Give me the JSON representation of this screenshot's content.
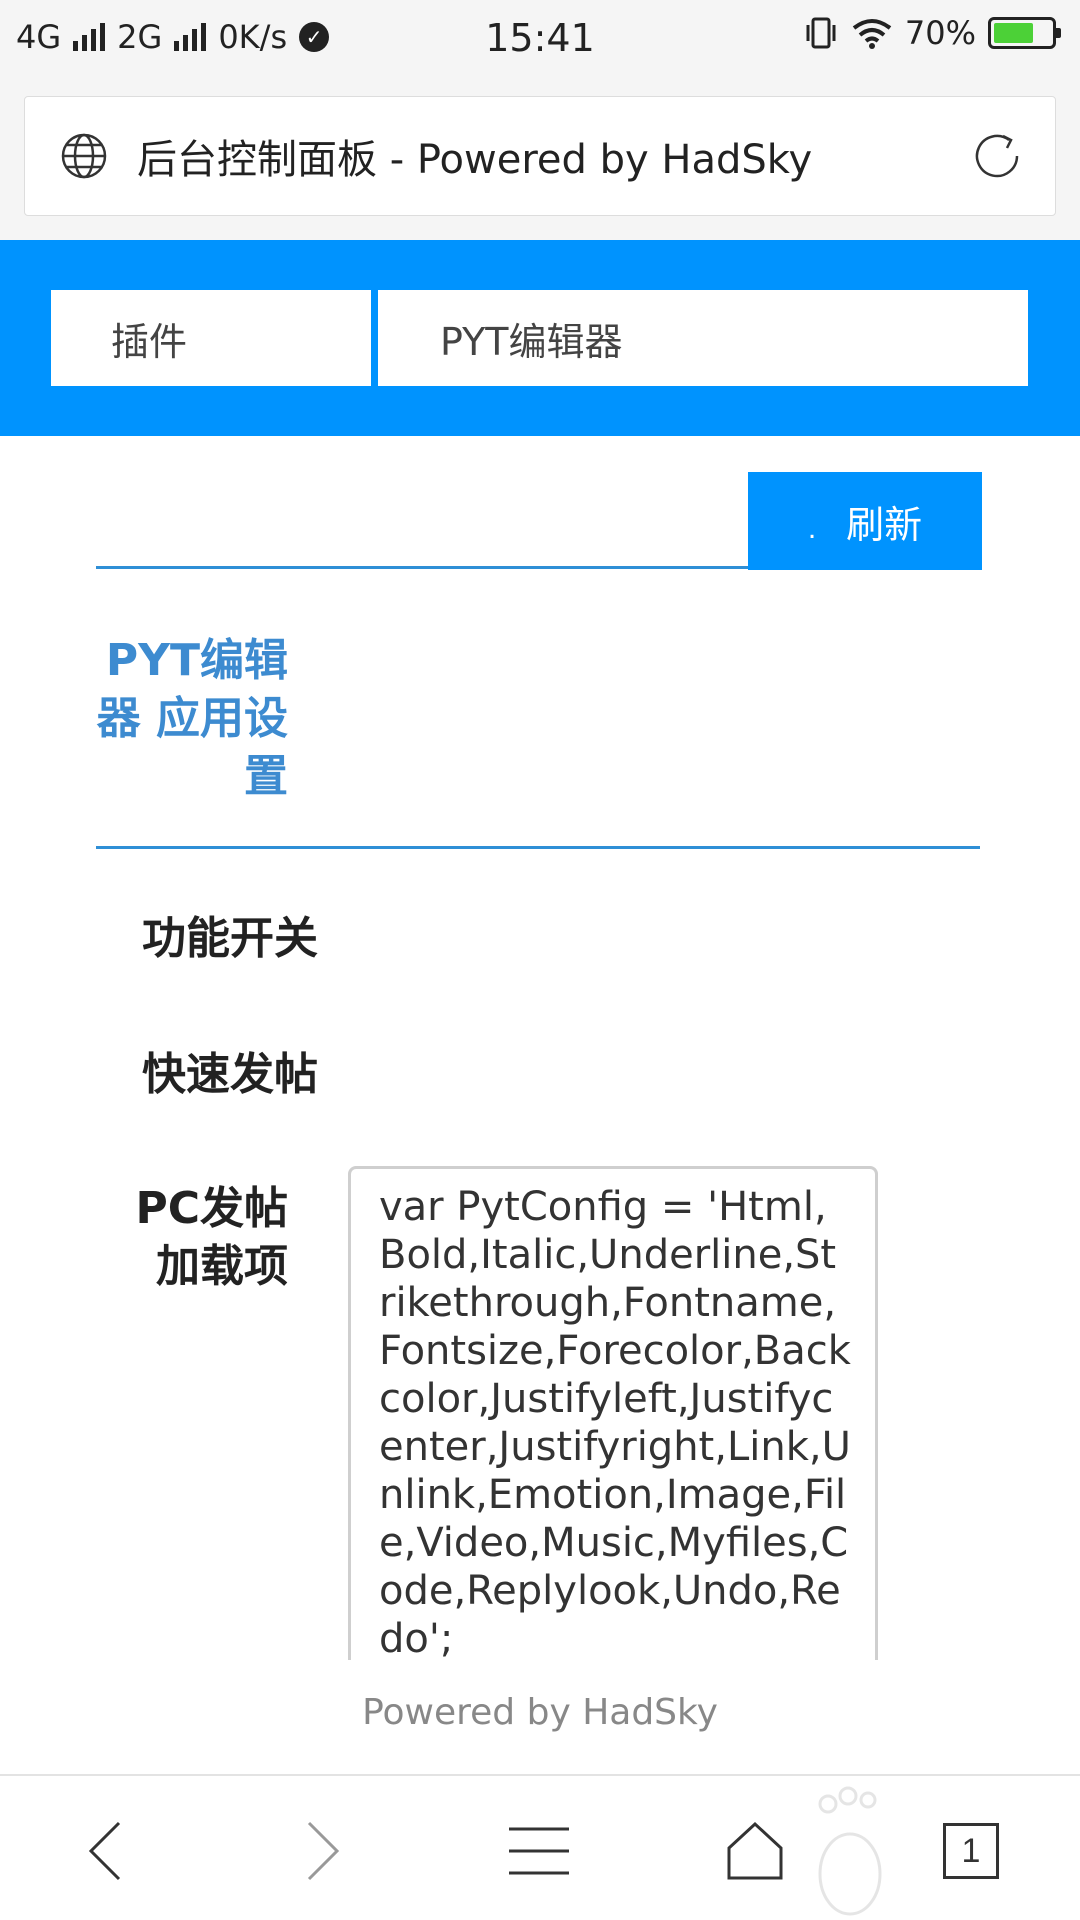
{
  "status_bar": {
    "network1": "4G",
    "network2": "2G",
    "speed": "0K/s",
    "time": "15:41",
    "battery_percent": "70%",
    "battery_level": 0.7
  },
  "address_bar": {
    "title": "后台控制面板 - Powered by HadSky",
    "icon": "globe-icon",
    "reload_icon": "reload-icon"
  },
  "breadcrumb": {
    "items": [
      {
        "label": "插件"
      },
      {
        "label": "PYT编辑器"
      }
    ]
  },
  "toolbar": {
    "refresh_dot": ".",
    "refresh_label": "刷新"
  },
  "section": {
    "title": "PYT编辑器 应用设置"
  },
  "form": {
    "switch_label": "功能开关",
    "quick_post_label": "快速发帖",
    "pc_load_label": "PC发帖加载项",
    "pc_load_value": "var PytConfig = 'Html,Bold,Italic,Underline,Strikethrough,Fontname,Fontsize,Forecolor,Backcolor,Justifyleft,Justifycenter,Justifyright,Link,Unlink,Emotion,Image,File,Video,Music,Myfiles,Code,Replylook,Undo,Redo';"
  },
  "footer": {
    "powered": "Powered by HadSky"
  },
  "bottom_nav": {
    "tab_count": "1"
  },
  "colors": {
    "brand_blue": "#0093fe",
    "section_blue": "#3d8bd0",
    "line_blue": "#2f8fd6"
  }
}
